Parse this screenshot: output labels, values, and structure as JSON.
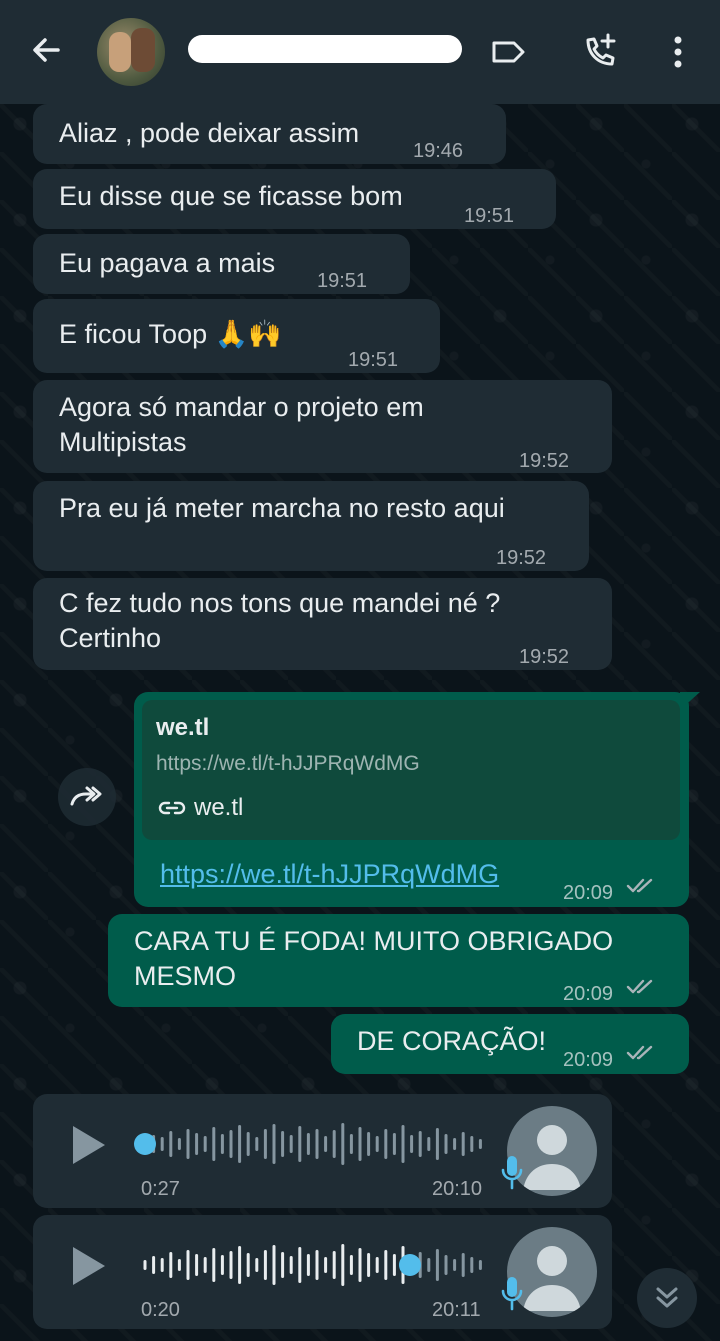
{
  "header": {
    "contact_name": "",
    "icons": [
      "back-arrow-icon",
      "label-icon",
      "add-call-icon",
      "more-vert-icon"
    ]
  },
  "colors": {
    "header_bg": "#1f2c34",
    "chat_bg": "#0b141a",
    "incoming_bubble": "#1f2c34",
    "outgoing_bubble": "#005c4b",
    "link": "#53bdeb",
    "read_ticks": "#8696a0"
  },
  "messages": [
    {
      "dir": "in",
      "text": "Aliaz , pode deixar assim",
      "time": "19:46"
    },
    {
      "dir": "in",
      "text": "Eu disse que se ficasse bom",
      "time": "19:51"
    },
    {
      "dir": "in",
      "text": "Eu pagava a mais",
      "time": "19:51"
    },
    {
      "dir": "in",
      "text": "E ficou Toop 🙏🙌",
      "time": "19:51"
    },
    {
      "dir": "in",
      "text": "Agora só mandar o projeto em\nMultipistas",
      "time": "19:52"
    },
    {
      "dir": "in",
      "text": "Pra eu já meter marcha no resto aqui",
      "time": "19:52"
    },
    {
      "dir": "in",
      "text": "C fez tudo nos tons que mandei né ?\nCertinho",
      "time": "19:52"
    },
    {
      "dir": "out",
      "type": "link",
      "preview_title": "we.tl",
      "preview_url": "https://we.tl/t-hJJPRqWdMG",
      "preview_domain": "we.tl",
      "text": "https://we.tl/t-hJJPRqWdMG",
      "time": "20:09",
      "status": "read"
    },
    {
      "dir": "out",
      "text": "CARA TU É FODA! MUITO OBRIGADO\nMESMO",
      "time": "20:09",
      "status": "read"
    },
    {
      "dir": "out",
      "text": "DE CORAÇÃO!",
      "time": "20:09",
      "status": "read"
    }
  ],
  "audios": [
    {
      "duration": "0:27",
      "time": "20:10",
      "progress": 0.0
    },
    {
      "duration": "0:20",
      "time": "20:11",
      "progress": 0.79
    }
  ]
}
